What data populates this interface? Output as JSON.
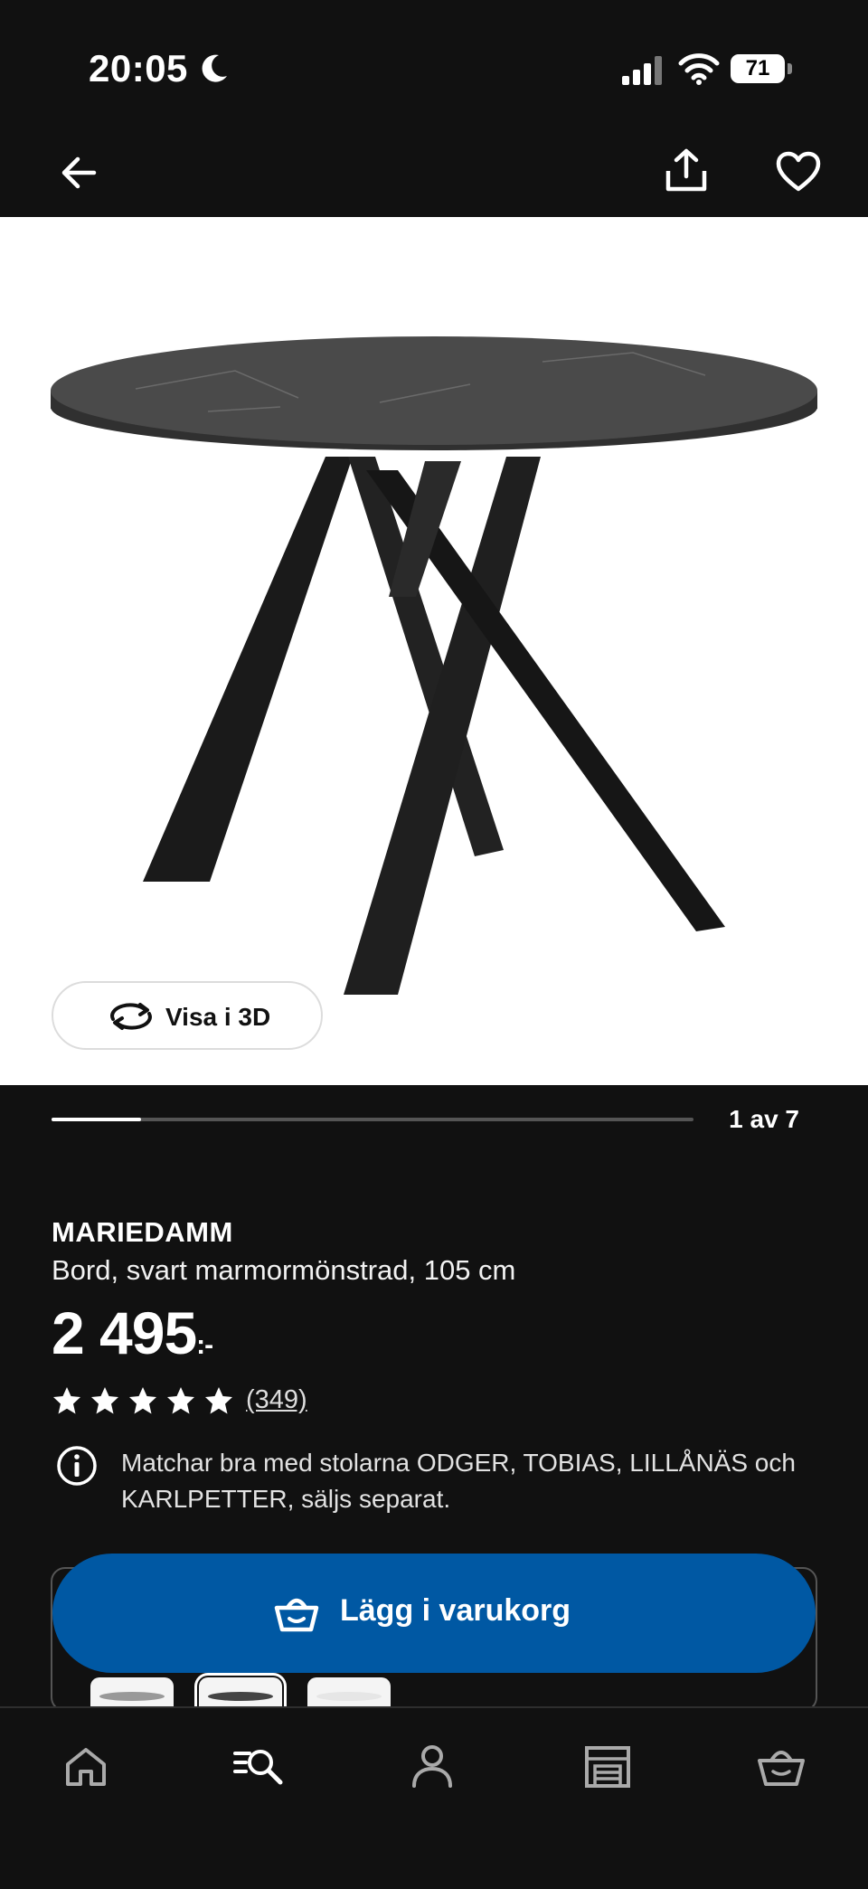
{
  "status_bar": {
    "time": "20:05",
    "battery": "71"
  },
  "nav": {
    "back": "back-arrow-icon",
    "share": "share-icon",
    "favorite": "heart-icon"
  },
  "gallery": {
    "view_3d_label": "Visa i 3D",
    "counter": "1 av 7",
    "progress": 0.14
  },
  "product": {
    "name": "MARIEDAMM",
    "description": "Bord, svart marmormönstrad, 105 cm",
    "price": "2 495",
    "price_suffix": ":-",
    "rating": 5,
    "review_count": "(349)",
    "info_text": "Matchar bra med stolarna ODGER, TOBIAS, LILLÅNÄS och KARLPETTER, säljs separat."
  },
  "cta": {
    "add_to_cart_label": "Lägg i varukorg"
  },
  "colors": {
    "brand_blue": "#0058a3",
    "background": "#111111"
  },
  "tab_bar": {
    "items": [
      "home-icon",
      "search-list-icon",
      "profile-icon",
      "store-icon",
      "cart-icon"
    ]
  }
}
